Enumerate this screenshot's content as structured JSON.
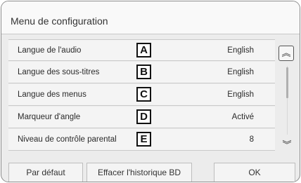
{
  "title": "Menu de configuration",
  "rows": [
    {
      "label": "Langue de l'audio",
      "marker": "A",
      "value": "English"
    },
    {
      "label": "Langue des sous-titres",
      "marker": "B",
      "value": "English"
    },
    {
      "label": "Langue des menus",
      "marker": "C",
      "value": "English"
    },
    {
      "label": "Marqueur d'angle",
      "marker": "D",
      "value": "Activé"
    },
    {
      "label": "Niveau de contrôle parental",
      "marker": "E",
      "value": "8"
    }
  ],
  "scroll": {
    "up_icon": "double-chevron-up-icon",
    "down_icon": "double-chevron-down-icon",
    "up_glyph": "︽",
    "down_glyph": "︾"
  },
  "buttons": {
    "default_label": "Par défaut",
    "clear_history_label": "Effacer l'historique BD",
    "ok_label": "OK"
  }
}
